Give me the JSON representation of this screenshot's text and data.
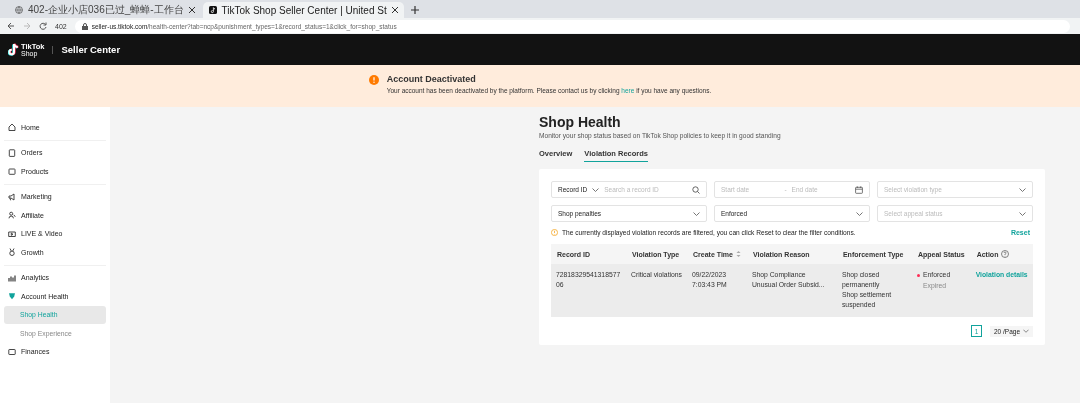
{
  "browser": {
    "tabs": [
      {
        "title": "402-企业小店036已过_蝉蝉-工作台",
        "selected": false
      },
      {
        "title": "TikTok Shop Seller Center | United St",
        "selected": true
      }
    ],
    "profile_label": "402",
    "url_host": "seller-us.tiktok.com",
    "url_path": "/health-center?tab=ncp&punishment_types=1&record_status=1&click_for=shop_status"
  },
  "header": {
    "logo_top": "TikTok",
    "logo_bottom": "Shop",
    "title": "Seller Center"
  },
  "banner": {
    "title": "Account Deactivated",
    "text_before": "Your account has been deactivated by the platform. Please contact us by clicking",
    "link": "here",
    "text_after": "if you have any questions."
  },
  "sidebar": {
    "groups": [
      [
        {
          "label": "Home",
          "selected": false
        }
      ],
      [
        {
          "label": "Orders",
          "selected": false
        },
        {
          "label": "Products",
          "selected": false
        }
      ],
      [
        {
          "label": "Marketing",
          "selected": false
        },
        {
          "label": "Affiliate",
          "selected": false
        },
        {
          "label": "LIVE & Video",
          "selected": false
        },
        {
          "label": "Growth",
          "selected": false
        }
      ],
      [
        {
          "label": "Analytics",
          "selected": false
        },
        {
          "label": "Account Health",
          "selected": false,
          "children": [
            {
              "label": "Shop Health",
              "selected": true
            },
            {
              "label": "Shop Experience",
              "selected": false
            }
          ]
        },
        {
          "label": "Finances",
          "selected": false
        }
      ]
    ]
  },
  "page": {
    "title": "Shop Health",
    "subtitle": "Monitor your shop status based on TikTok Shop policies to keep it in good standing",
    "tabs": [
      {
        "label": "Overview",
        "selected": false
      },
      {
        "label": "Violation Records",
        "selected": true
      }
    ]
  },
  "filters": {
    "search_type": "Record ID",
    "search_placeholder": "Search a record ID",
    "start_placeholder": "Start date",
    "date_separator": "-",
    "end_placeholder": "End date",
    "violation_type_placeholder": "Select violation type",
    "penalty": "Shop penalties",
    "status": "Enforced",
    "appeal_placeholder": "Select appeal status"
  },
  "notice": {
    "text": "The currently displayed violation records are filtered, you can click Reset to clear the filter conditions.",
    "reset": "Reset"
  },
  "table": {
    "columns": [
      {
        "label": "Record ID",
        "kind": "plain"
      },
      {
        "label": "Violation Type",
        "kind": "plain"
      },
      {
        "label": "Create Time",
        "kind": "sort"
      },
      {
        "label": "Violation Reason",
        "kind": "plain"
      },
      {
        "label": "Enforcement Type",
        "kind": "plain"
      },
      {
        "label": "Appeal Status",
        "kind": "plain"
      },
      {
        "label": "Action",
        "kind": "help"
      }
    ],
    "rows": [
      {
        "record_id": "7281832954131857706",
        "violation_type": "Critical violations",
        "create_time": [
          "09/22/2023",
          "7:03:43 PM"
        ],
        "violation_reason": [
          "Shop Compliance",
          "Unusual Order Subsid..."
        ],
        "enforcement_type": [
          "Shop closed permanently",
          "Shop settlement suspended"
        ],
        "appeal_status": "Enforced",
        "appeal_note": "Expired",
        "action": "Violation details"
      }
    ]
  },
  "pagination": {
    "pages": [
      {
        "label": "1",
        "selected": true
      }
    ],
    "page_size": "20 /Page"
  }
}
